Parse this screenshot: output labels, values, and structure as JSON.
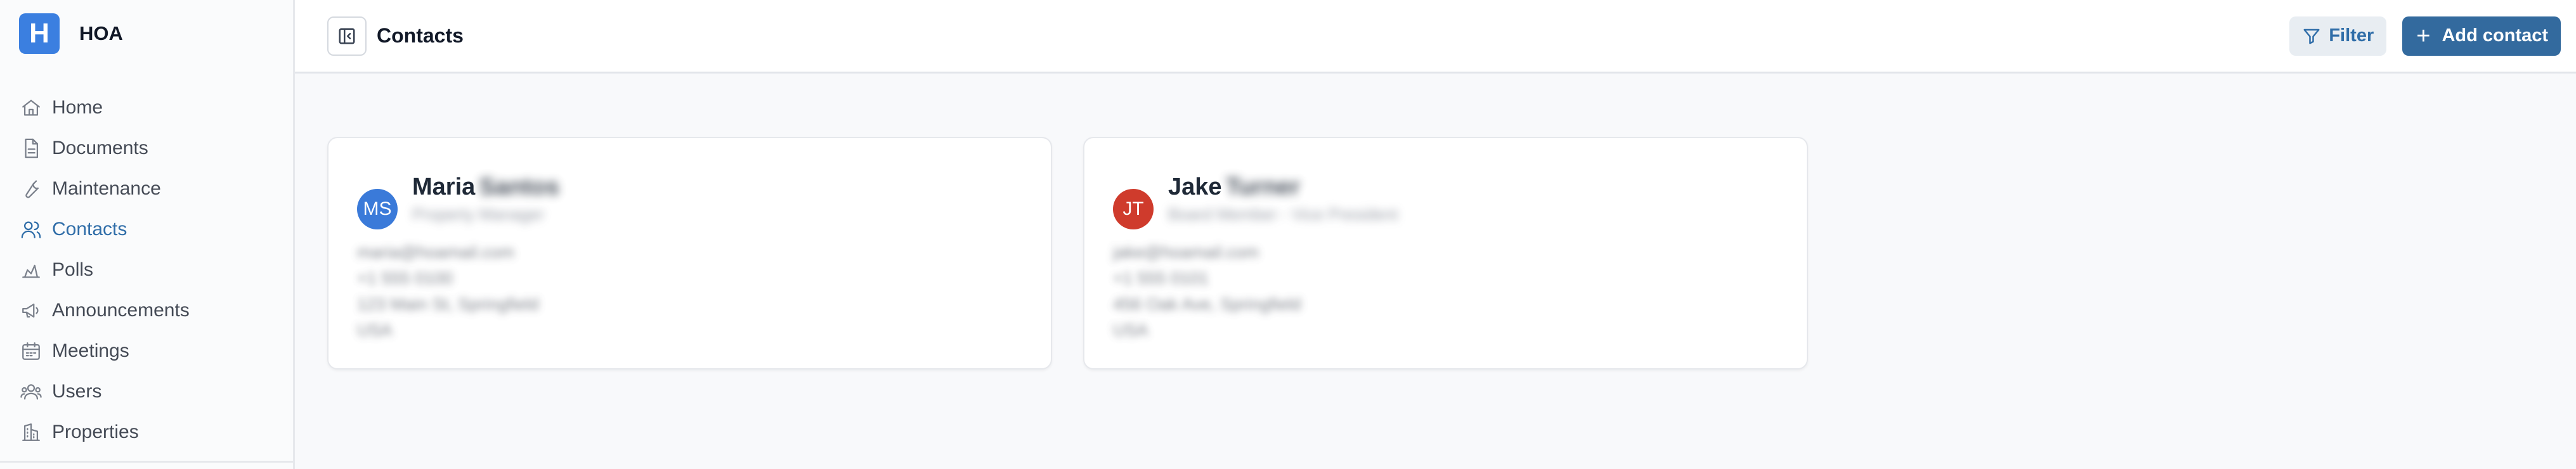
{
  "sidebar": {
    "brand_letter": "H",
    "brand_name": "HOA",
    "items": [
      {
        "label": "Home",
        "icon": "home-icon"
      },
      {
        "label": "Documents",
        "icon": "document-icon"
      },
      {
        "label": "Maintenance",
        "icon": "wrench-icon"
      },
      {
        "label": "Contacts",
        "icon": "contacts-icon",
        "active": true
      },
      {
        "label": "Polls",
        "icon": "poll-icon"
      },
      {
        "label": "Announcements",
        "icon": "megaphone-icon"
      },
      {
        "label": "Meetings",
        "icon": "calendar-icon"
      },
      {
        "label": "Users",
        "icon": "users-icon"
      },
      {
        "label": "Properties",
        "icon": "building-icon"
      }
    ]
  },
  "header": {
    "title": "Contacts",
    "filter_label": "Filter",
    "add_label": "Add contact",
    "add_icon": "+"
  },
  "contacts": [
    {
      "initials": "MS",
      "first_name": "Maria",
      "last_name": "Santos",
      "role": "Property Manager",
      "email": "maria@hoamail.com",
      "phone": "+1 555 0100",
      "address": "123 Main St, Springfield",
      "country": "USA",
      "avatar_color": "#3a7ad9"
    },
    {
      "initials": "JT",
      "first_name": "Jake",
      "last_name": "Turner",
      "role": "Board Member - Vice President",
      "email": "jake@hoamail.com",
      "phone": "+1 555 0101",
      "address": "456 Oak Ave, Springfield",
      "country": "USA",
      "avatar_color": "#cf3b2c"
    }
  ],
  "colors": {
    "accent": "#336a9e",
    "active_nav": "#2f6da8",
    "brand": "#3b7fe0"
  }
}
